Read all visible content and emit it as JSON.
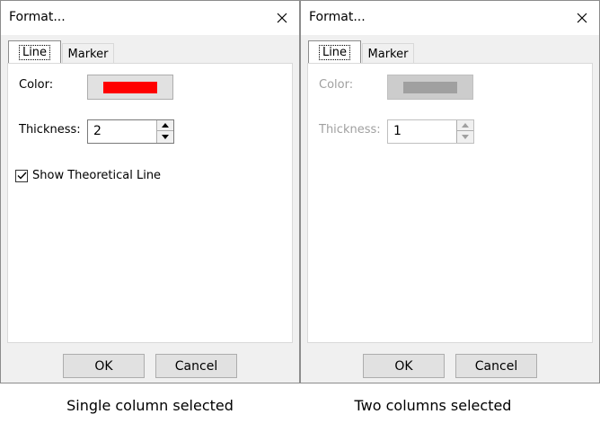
{
  "left": {
    "title": "Format...",
    "tabs": [
      "Line",
      "Marker"
    ],
    "color_label": "Color:",
    "color_swatch": "#ff0000",
    "thickness_label": "Thickness:",
    "thickness_value": "2",
    "show_line_label": "Show Theoretical Line",
    "show_line_checked": true,
    "ok_label": "OK",
    "cancel_label": "Cancel",
    "caption": "Single column selected"
  },
  "right": {
    "title": "Format...",
    "tabs": [
      "Line",
      "Marker"
    ],
    "color_label": "Color:",
    "color_swatch": "#a0a0a0",
    "thickness_label": "Thickness:",
    "thickness_value": "1",
    "ok_label": "OK",
    "cancel_label": "Cancel",
    "caption": "Two columns selected"
  }
}
